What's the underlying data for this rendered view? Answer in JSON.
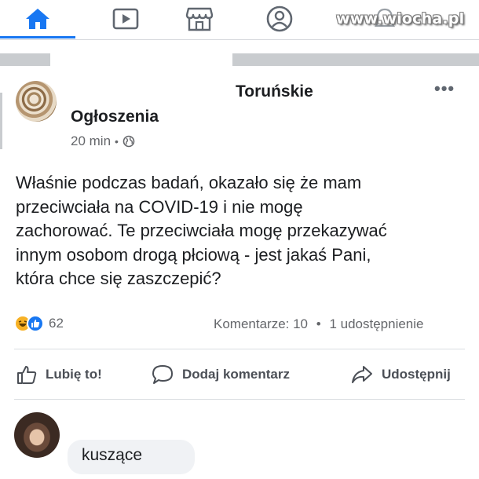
{
  "watermark": "www.wiocha.pl",
  "nav": {
    "items": [
      {
        "icon": "home-icon",
        "active": true
      },
      {
        "icon": "video-icon",
        "active": false
      },
      {
        "icon": "marketplace-icon",
        "active": false
      },
      {
        "icon": "profile-icon",
        "active": false
      },
      {
        "icon": "notifications-icon",
        "active": false
      }
    ],
    "accent_color": "#1877f2"
  },
  "post": {
    "page_name_line1": "Toruńskie",
    "page_name_line2": "Ogłoszenia",
    "time": "20 min",
    "meta_separator": "•",
    "more": "•••",
    "text_lines": [
      "Właśnie podczas badań, okazało się że mam",
      "przeciwciała na COVID-19 i nie mogę",
      "zachorować. Te przeciwciała mogę przekazywać",
      "innym osobom drogą płciową - jest jakaś Pani,",
      "która chce się zaszczepić?"
    ],
    "reactions": {
      "icons": [
        "haha-icon",
        "like-icon"
      ],
      "count": "62"
    },
    "comments_label": "Komentarze: 10",
    "stats_separator": "•",
    "shares_label": "1 udostępnienie"
  },
  "actions": {
    "like": "Lubię to!",
    "comment": "Dodaj komentarz",
    "share": "Udostępnij"
  },
  "comment": {
    "text": "kuszące"
  }
}
